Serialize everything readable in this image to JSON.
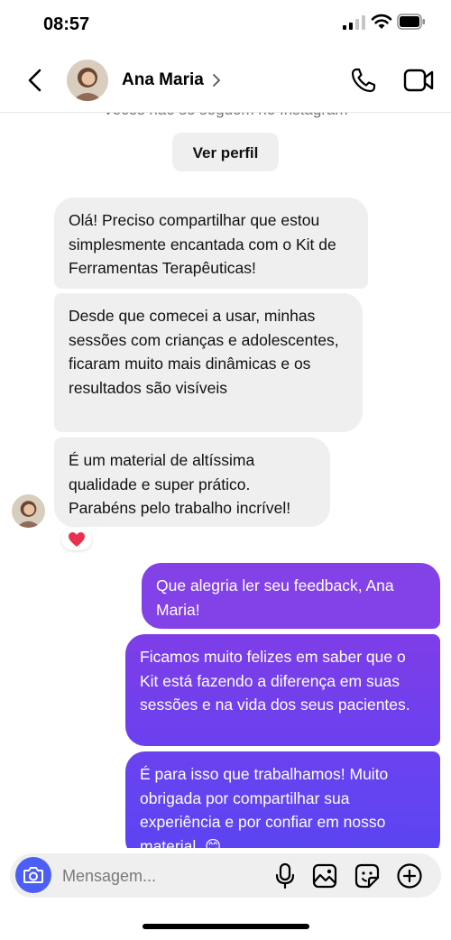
{
  "status": {
    "time": "08:57"
  },
  "header": {
    "contact_name": "Ana Maria"
  },
  "intro": {
    "follow_note": "Vocês não se seguem no Instagram",
    "view_profile_label": "Ver perfil"
  },
  "messages": [
    {
      "direction": "in",
      "text": "Olá! Preciso compartilhar que estou simplesmente encantada com o Kit de Ferramentas Terapêuticas!"
    },
    {
      "direction": "in",
      "text": "Desde que comecei a usar, minhas sessões com crianças e adolescentes, ficaram muito mais dinâmicas e os resultados são visíveis"
    },
    {
      "direction": "in",
      "text": " É um material de altíssima qualidade e super prático. Parabéns pelo trabalho incrível!",
      "reaction": "❤️"
    },
    {
      "direction": "out",
      "text": "Que alegria ler seu feedback, Ana Maria!"
    },
    {
      "direction": "out",
      "text": "Ficamos muito felizes em saber que o Kit está fazendo a diferença em suas sessões e na vida dos seus pacientes."
    },
    {
      "direction": "out",
      "text": " É para isso que trabalhamos! Muito obrigada por compartilhar sua experiência e por confiar em nosso material. 😊"
    }
  ],
  "composer": {
    "placeholder": "Mensagem..."
  },
  "colors": {
    "outgoing": "#8341e8",
    "incoming": "#efefef",
    "camera": "#4b5ff6"
  },
  "icons": [
    "back-icon",
    "phone-icon",
    "video-icon",
    "camera-icon",
    "microphone-icon",
    "gallery-icon",
    "sticker-icon",
    "plus-icon"
  ]
}
